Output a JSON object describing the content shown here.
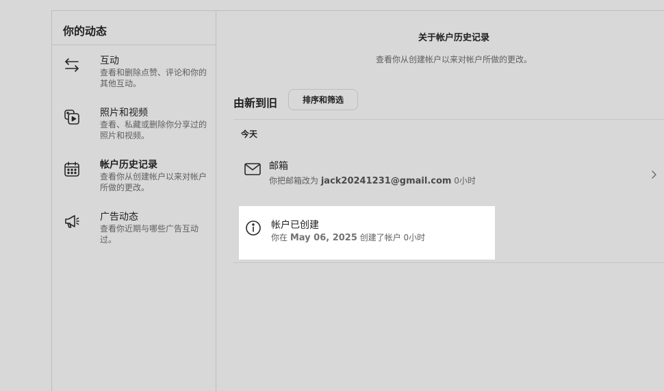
{
  "left_panel": {
    "title": "你的动态",
    "items": [
      {
        "icon": "arrows-exchange-icon",
        "label": "互动",
        "desc": "查看和删除点赞、评论和你的其他互动。"
      },
      {
        "icon": "photo-video-icon",
        "label": "照片和视频",
        "desc": "查看、私藏或删除你分享过的照片和视频。"
      },
      {
        "icon": "calendar-icon",
        "label": "帐户历史记录",
        "desc": "查看你从创建帐户以来对帐户所做的更改。",
        "active": true
      },
      {
        "icon": "megaphone-icon",
        "label": "广告动态",
        "desc": "查看你近期与哪些广告互动过。"
      }
    ]
  },
  "main": {
    "about_title": "关于帐户历史记录",
    "about_desc": "查看你从创建帐户以来对帐户所做的更改。",
    "sort_label": "由新到旧",
    "sort_button": "排序和筛选",
    "section_label": "今天",
    "entries": [
      {
        "icon": "mail-icon",
        "title": "邮箱",
        "sub_prefix": "你把邮箱改为",
        "sub_value": "jack20241231@gmail.com",
        "sub_suffix": "0小时"
      },
      {
        "icon": "info-icon",
        "title": "帐户已创建",
        "sub_prefix": "你在",
        "sub_value": "May 06, 2025",
        "sub_suffix": "创建了帐户 0小时"
      }
    ]
  },
  "colors": {
    "background": "#d8d8d8",
    "highlight": "#ffffff",
    "text_primary": "#1f1f1f",
    "text_secondary": "#5e5e5e"
  }
}
